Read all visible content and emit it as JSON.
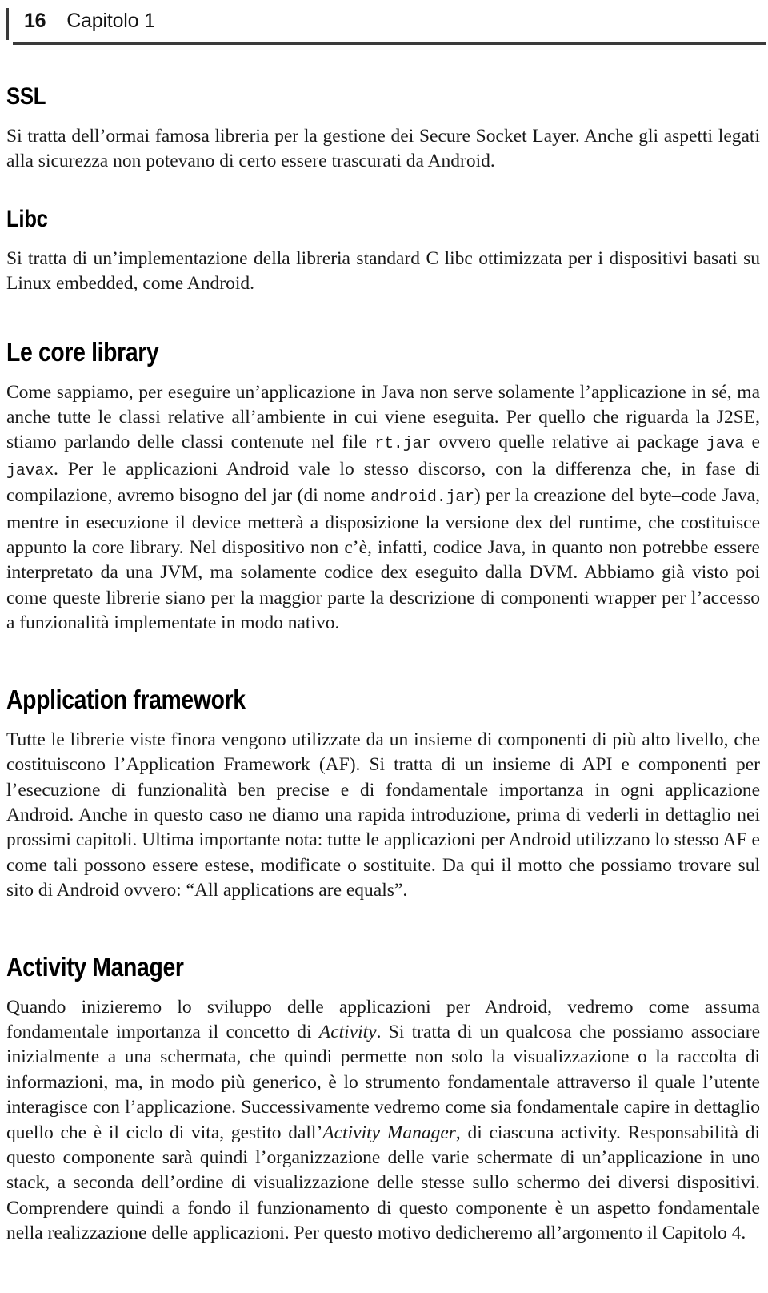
{
  "page": {
    "folio": "16",
    "chapter_label": "Capitolo 1"
  },
  "sections": [
    {
      "heading": "SSL",
      "paragraph": "Si tratta dell’ormai famosa libreria per la gestione dei Secure Socket Layer. Anche gli aspetti legati alla sicurezza non potevano di certo essere trascurati da Android."
    },
    {
      "heading": "Libc",
      "paragraph": "Si tratta di un’implementazione della libreria standard C libc ottimizzata per i dispositivi basati su Linux embedded, come Android."
    },
    {
      "heading": "Le core library",
      "paragraph_parts": {
        "p1": "Come sappiamo, per eseguire un’applicazione in Java non serve solamente l’applicazione in sé, ma anche tutte le classi relative all’ambiente in cui viene eseguita. Per quello che riguarda la J2SE, stiamo parlando delle classi contenute nel file ",
        "code1": "rt.jar",
        "p2": " ovvero quelle relative ai package ",
        "code2": "java",
        "p3": " e ",
        "code3": "javax",
        "p4": ". Per le applicazioni Android vale lo stesso discorso, con la differenza che, in fase di compilazione, avremo bisogno del jar (di nome ",
        "code4": "android.jar",
        "p5": ") per la creazione del byte–code Java, mentre in esecuzione il device metterà a disposizione la versione dex del runtime, che costituisce appunto la core library. Nel dispositivo non c’è, infatti, codice Java, in quanto non potrebbe essere interpretato da una JVM, ma solamente codice dex eseguito dalla DVM. Abbiamo già visto poi come queste librerie siano per la maggior parte la descrizione di componenti wrapper per l’accesso a funzionalità implementate in modo nativo."
      }
    },
    {
      "heading": "Application framework",
      "paragraph": "Tutte le librerie viste finora vengono utilizzate da un insieme di componenti di più alto livello, che costituiscono l’Application Framework (AF). Si tratta di un insieme di API e componenti per l’esecuzione di funzionalità ben precise e di fondamentale importanza in ogni applicazione Android. Anche in questo caso ne diamo una rapida introduzione, prima di vederli in dettaglio nei prossimi capitoli. Ultima importante nota: tutte le applicazioni per Android utilizzano lo stesso AF e come tali possono essere estese, modificate o sostituite. Da qui il motto che possiamo trovare sul sito di Android ovvero: “All applications are equals”."
    },
    {
      "heading": "Activity Manager",
      "paragraph_parts": {
        "p1": "Quando inizieremo lo sviluppo delle applicazioni per Android, vedremo come assuma fondamentale importanza il concetto di ",
        "ital1": "Activity",
        "p2": ". Si tratta di un qualcosa che possiamo associare inizialmente a una schermata, che quindi permette non solo la visualizzazione o la raccolta di informazioni, ma, in modo più generico, è lo strumento fondamentale attraverso il quale l’utente interagisce con l’applicazione. Successivamente vedremo come sia fondamentale capire in dettaglio quello che è il ciclo di vita, gestito dall’",
        "ital2": "Activity Manager",
        "p3": ", di ciascuna activity. Responsabilità di questo componente sarà quindi l’organizzazione delle varie schermate di un’applicazione in uno stack, a seconda dell’ordine di visualizzazione delle stesse sullo schermo dei diversi dispositivi. Comprendere quindi a fondo il funzionamento di questo componente è un aspetto fondamentale nella realizzazione delle applicazioni. Per questo motivo dedicheremo all’argomento il Capitolo 4."
      }
    }
  ],
  "colors": {
    "rule": "#3a3a3a",
    "text": "#1a1a1a",
    "heading": "#000000",
    "background": "#ffffff"
  }
}
